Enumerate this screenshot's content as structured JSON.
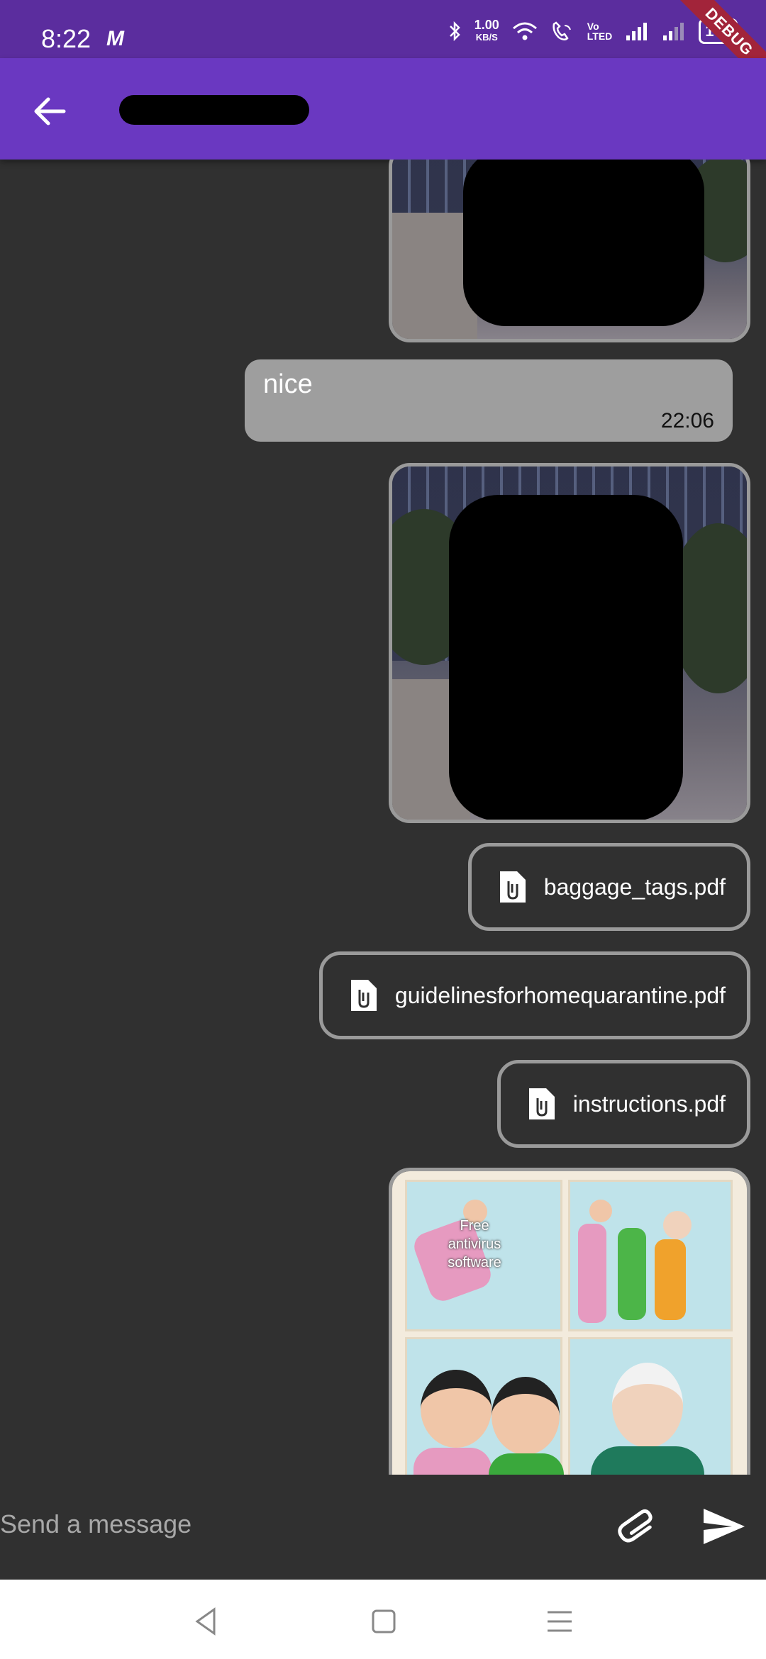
{
  "status_bar": {
    "time": "8:22",
    "app_indicator": "M",
    "net_speed_value": "1.00",
    "net_speed_unit": "KB/S",
    "volte_top": "Vo",
    "volte_bottom": "LTED",
    "battery": "100",
    "debug_banner": "DEBUG",
    "icons": [
      "bluetooth-icon",
      "wifi-icon",
      "wifi-calling-icon",
      "signal-icon",
      "signal-weak-icon",
      "battery-icon"
    ]
  },
  "app_bar": {
    "back_icon": "arrow-back-icon",
    "title_redacted": true
  },
  "messages": [
    {
      "type": "image",
      "redacted": true
    },
    {
      "type": "text",
      "text": "nice",
      "time": "22:06"
    },
    {
      "type": "image",
      "redacted": true
    },
    {
      "type": "file",
      "icon": "attachment-file-icon",
      "name": "baggage_tags.pdf"
    },
    {
      "type": "file",
      "icon": "attachment-file-icon",
      "name": "guidelinesforhomequarantine.pdf"
    },
    {
      "type": "file",
      "icon": "attachment-file-icon",
      "name": "instructions.pdf"
    },
    {
      "type": "image",
      "caption": "Free antivirus software"
    }
  ],
  "composer": {
    "placeholder": "Send a message",
    "attach_icon": "paperclip-icon",
    "send_icon": "send-icon"
  },
  "nav_bar": {
    "icons": [
      "nav-back-icon",
      "nav-home-icon",
      "nav-menu-icon"
    ]
  },
  "colors": {
    "status_bar": "#5b2d9e",
    "app_bar": "#6a38c1",
    "background": "#303030",
    "bubble": "#9e9e9e",
    "bubble_border": "#9a9a9a"
  }
}
